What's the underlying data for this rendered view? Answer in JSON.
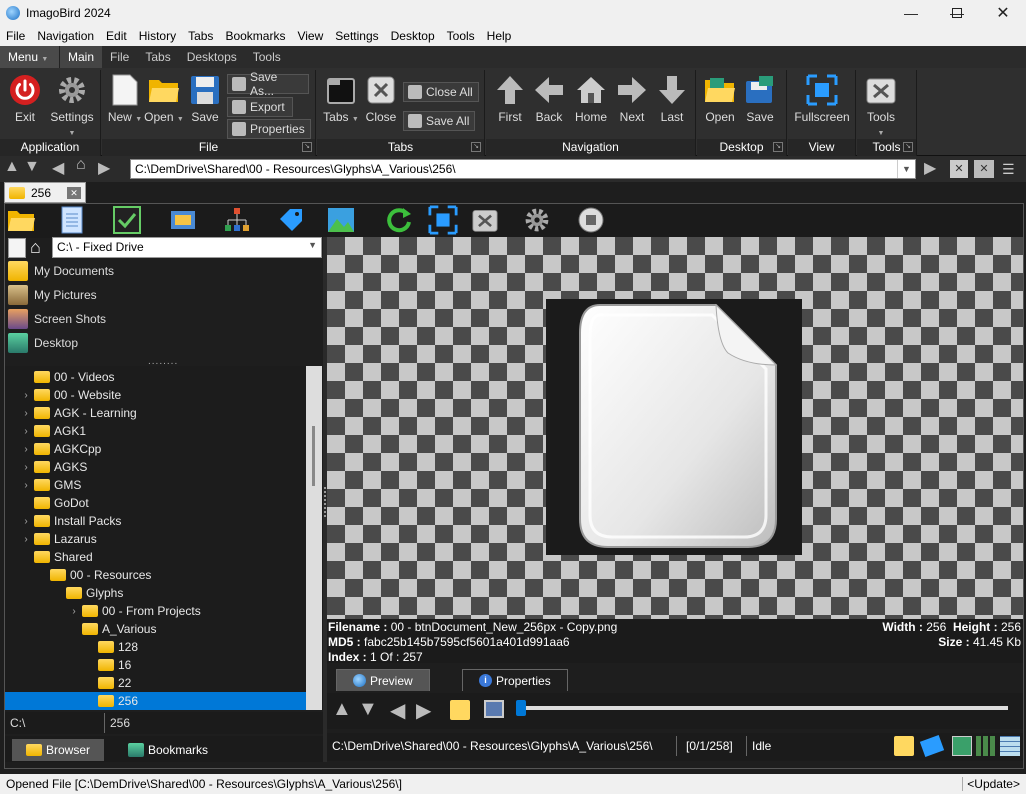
{
  "window": {
    "title": "ImagoBird 2024"
  },
  "menubar": [
    "File",
    "Navigation",
    "Edit",
    "History",
    "Tabs",
    "Bookmarks",
    "View",
    "Settings",
    "Desktop",
    "Tools",
    "Help"
  ],
  "ribbon_tabs": {
    "menu": "Menu",
    "tabs": [
      "Main",
      "File",
      "Tabs",
      "Desktops",
      "Tools"
    ],
    "active": "Main"
  },
  "ribbon": {
    "application": {
      "caption": "Application",
      "exit": "Exit",
      "settings": "Settings"
    },
    "file": {
      "caption": "File",
      "new": "New",
      "open": "Open",
      "save": "Save",
      "save_as": "Save As...",
      "export": "Export",
      "properties": "Properties"
    },
    "tabs": {
      "caption": "Tabs",
      "tabs": "Tabs",
      "close": "Close",
      "close_all": "Close All",
      "save_all": "Save All"
    },
    "navigation": {
      "caption": "Navigation",
      "first": "First",
      "back": "Back",
      "home": "Home",
      "next": "Next",
      "last": "Last"
    },
    "desktop": {
      "caption": "Desktop",
      "open": "Open",
      "save": "Save"
    },
    "view": {
      "caption": "View",
      "fullscreen": "Fullscreen"
    },
    "tools": {
      "caption": "Tools",
      "tools": "Tools"
    }
  },
  "address": {
    "path": "C:\\DemDrive\\Shared\\00 - Resources\\Glyphs\\A_Various\\256\\"
  },
  "doc_tab": {
    "label": "256"
  },
  "browser": {
    "drive": "C:\\ - Fixed Drive",
    "quick": [
      "My Documents",
      "My Pictures",
      "Screen Shots",
      "Desktop"
    ],
    "dots": "........",
    "tree": [
      {
        "label": "00 - Videos",
        "expandable": false
      },
      {
        "label": "00 - Website",
        "expandable": true
      },
      {
        "label": "AGK - Learning",
        "expandable": true
      },
      {
        "label": "AGK1",
        "expandable": true
      },
      {
        "label": "AGKCpp",
        "expandable": true
      },
      {
        "label": "AGKS",
        "expandable": true
      },
      {
        "label": "GMS",
        "expandable": true
      },
      {
        "label": "GoDot",
        "expandable": false
      },
      {
        "label": "Install Packs",
        "expandable": true
      },
      {
        "label": "Lazarus",
        "expandable": true
      },
      {
        "label": "Shared",
        "expandable": false
      },
      {
        "label": "00 - Resources",
        "expandable": false
      },
      {
        "label": "Glyphs",
        "expandable": false
      },
      {
        "label": "00 - From Projects",
        "expandable": true
      },
      {
        "label": "A_Various",
        "expandable": false
      },
      {
        "label": "128",
        "expandable": false
      },
      {
        "label": "16",
        "expandable": false
      },
      {
        "label": "22",
        "expandable": false
      },
      {
        "label": "256",
        "expandable": false,
        "selected": true
      }
    ],
    "path": "C:\\",
    "name": "256",
    "tabs": [
      "Browser",
      "Bookmarks"
    ]
  },
  "info": {
    "filename_label": "Filename :",
    "filename": "00 - btnDocument_New_256px - Copy.png",
    "md5_label": "MD5 :",
    "md5": "fabc25b145b7595cf5601a401d991aa6",
    "index_label": "Index :",
    "index": "1 Of : 257",
    "width_label": "Width :",
    "width": "256",
    "height_label": "Height :",
    "height": "256",
    "size_label": "Size :",
    "size": "41.45 Kb"
  },
  "preview_tabs": [
    "Preview",
    "Properties"
  ],
  "viewer_status": {
    "path": "C:\\DemDrive\\Shared\\00 - Resources\\Glyphs\\A_Various\\256\\",
    "counter": "[0/1/258]",
    "state": "Idle"
  },
  "statusbar": {
    "message": "Opened File [C:\\DemDrive\\Shared\\00 - Resources\\Glyphs\\A_Various\\256\\]",
    "update": "<Update>"
  },
  "colors": {
    "accent": "#0078d7",
    "panel": "#1e1e1e",
    "ribbon": "#2f2f2f"
  }
}
